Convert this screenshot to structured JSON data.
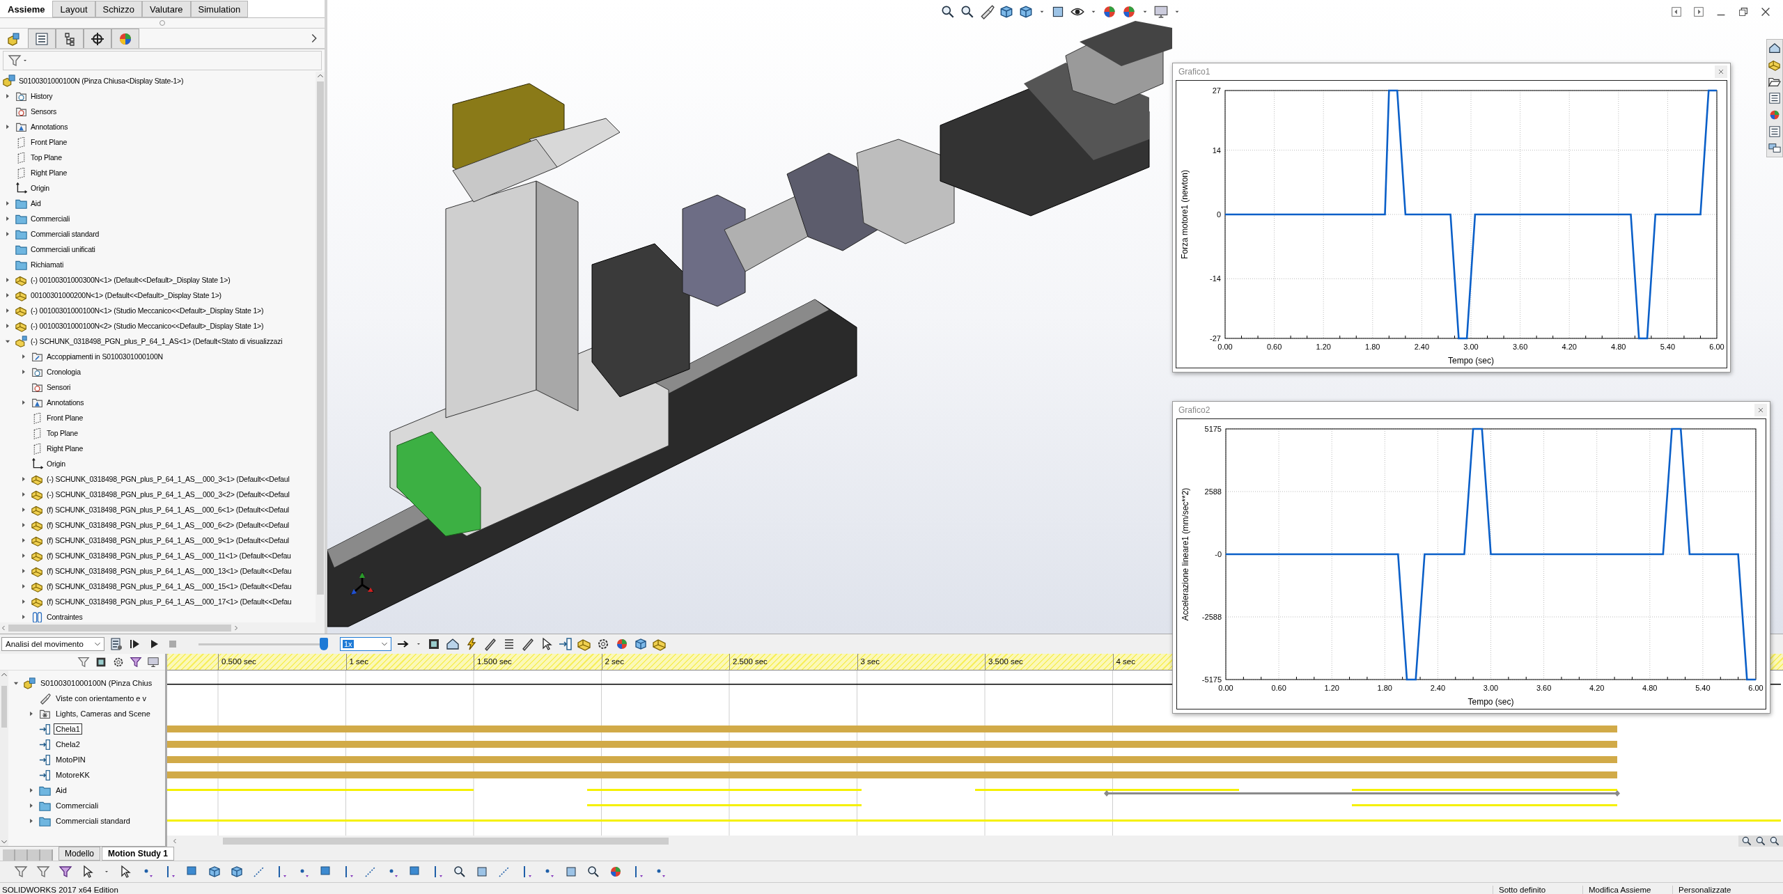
{
  "ribbon_tabs": [
    {
      "label": "Assieme",
      "selected": true
    },
    {
      "label": "Layout",
      "selected": false
    },
    {
      "label": "Schizzo",
      "selected": false
    },
    {
      "label": "Valutare",
      "selected": false
    },
    {
      "label": "Simulation",
      "selected": false
    }
  ],
  "panel_tabs": [
    {
      "kind": "tree",
      "selected": true
    },
    {
      "kind": "properties",
      "selected": false
    },
    {
      "kind": "configurations",
      "selected": false
    },
    {
      "kind": "dimxpert",
      "selected": false
    },
    {
      "kind": "display",
      "selected": false
    }
  ],
  "tree": {
    "root": {
      "label": "S0100301000100N  (Pinza Chiusa<Display State-1>)",
      "kind": "assembly"
    },
    "items": [
      {
        "label": "History",
        "kind": "history",
        "expanded": false
      },
      {
        "label": "Sensors",
        "kind": "sensor"
      },
      {
        "label": "Annotations",
        "kind": "annotation",
        "expanded": false
      },
      {
        "label": "Front Plane",
        "kind": "plane"
      },
      {
        "label": "Top Plane",
        "kind": "plane"
      },
      {
        "label": "Right Plane",
        "kind": "plane"
      },
      {
        "label": "Origin",
        "kind": "origin"
      },
      {
        "label": "Aid",
        "kind": "folder",
        "expanded": false
      },
      {
        "label": "Commerciali",
        "kind": "folder",
        "expanded": false
      },
      {
        "label": "Commerciali standard",
        "kind": "folder",
        "expanded": false
      },
      {
        "label": "Commerciali unificati",
        "kind": "folder"
      },
      {
        "label": "Richiamati",
        "kind": "folder"
      },
      {
        "label": "(-) 00100301000300N<1> (Default<<Default>_Display State 1>)",
        "kind": "part",
        "expanded": false
      },
      {
        "label": "00100301000200N<1> (Default<<Default>_Display State 1>)",
        "kind": "part",
        "expanded": false
      },
      {
        "label": "(-) 00100301000100N<1> (Studio Meccanico<<Default>_Display State 1>)",
        "kind": "part",
        "expanded": false
      },
      {
        "label": "(-) 00100301000100N<2> (Studio Meccanico<<Default>_Display State 1>)",
        "kind": "part",
        "expanded": false
      },
      {
        "label": "(-) SCHUNK_0318498_PGN_plus_P_64_1_AS<1> (Default<Stato di visualizzazi",
        "kind": "subassembly",
        "expanded": true,
        "children": [
          {
            "label": "Accoppiamenti in S0100301000100N",
            "kind": "mates",
            "expanded": false
          },
          {
            "label": "Cronologia",
            "kind": "history",
            "expanded": false
          },
          {
            "label": "Sensori",
            "kind": "sensor"
          },
          {
            "label": "Annotations",
            "kind": "annotation",
            "expanded": false
          },
          {
            "label": "Front Plane",
            "kind": "plane"
          },
          {
            "label": "Top Plane",
            "kind": "plane"
          },
          {
            "label": "Right Plane",
            "kind": "plane"
          },
          {
            "label": "Origin",
            "kind": "origin"
          },
          {
            "label": "(-) SCHUNK_0318498_PGN_plus_P_64_1_AS__000_3<1> (Default<<Defaul",
            "kind": "part",
            "expanded": false
          },
          {
            "label": "(-) SCHUNK_0318498_PGN_plus_P_64_1_AS__000_3<2> (Default<<Defaul",
            "kind": "part",
            "expanded": false
          },
          {
            "label": "(f) SCHUNK_0318498_PGN_plus_P_64_1_AS__000_6<1> (Default<<Defaul",
            "kind": "part",
            "expanded": false
          },
          {
            "label": "(f) SCHUNK_0318498_PGN_plus_P_64_1_AS__000_6<2> (Default<<Defaul",
            "kind": "part",
            "expanded": false
          },
          {
            "label": "(f) SCHUNK_0318498_PGN_plus_P_64_1_AS__000_9<1> (Default<<Defaul",
            "kind": "part",
            "expanded": false
          },
          {
            "label": "(f) SCHUNK_0318498_PGN_plus_P_64_1_AS__000_11<1> (Default<<Defau",
            "kind": "part",
            "expanded": false
          },
          {
            "label": "(f) SCHUNK_0318498_PGN_plus_P_64_1_AS__000_13<1> (Default<<Defau",
            "kind": "part",
            "expanded": false
          },
          {
            "label": "(f) SCHUNK_0318498_PGN_plus_P_64_1_AS__000_15<1> (Default<<Defau",
            "kind": "part",
            "expanded": false
          },
          {
            "label": "(f) SCHUNK_0318498_PGN_plus_P_64_1_AS__000_17<1> (Default<<Defau",
            "kind": "part",
            "expanded": false
          },
          {
            "label": "Contraintes",
            "kind": "paperclip",
            "expanded": false
          }
        ]
      }
    ]
  },
  "graphs": [
    {
      "title": "Grafico1",
      "chart_data": {
        "type": "line",
        "grid": true,
        "xlabel": "Tempo (sec)",
        "ylabel": "Forza motore1 (newton)",
        "xlim": [
          0,
          6
        ],
        "ylim": [
          -27,
          27
        ],
        "x": [
          0,
          1.95,
          2.0,
          2.1,
          2.2,
          2.75,
          2.85,
          2.95,
          3.05,
          4.95,
          5.05,
          5.15,
          5.25,
          5.8,
          5.9,
          6.0
        ],
        "values": [
          0,
          0,
          27,
          27,
          0,
          0,
          -27,
          -27,
          0,
          0,
          -27,
          -27,
          0,
          0,
          27,
          27
        ],
        "xticks": [
          {
            "value": 0,
            "label": "0.00"
          },
          {
            "value": 0.6,
            "label": "0.60"
          },
          {
            "value": 1.2,
            "label": "1.20"
          },
          {
            "value": 1.8,
            "label": "1.80"
          },
          {
            "value": 2.4,
            "label": "2.40"
          },
          {
            "value": 3.0,
            "label": "3.00"
          },
          {
            "value": 3.6,
            "label": "3.60"
          },
          {
            "value": 4.2,
            "label": "4.20"
          },
          {
            "value": 4.8,
            "label": "4.80"
          },
          {
            "value": 5.4,
            "label": "5.40"
          },
          {
            "value": 6.0,
            "label": "6.00"
          }
        ],
        "yticks": [
          {
            "value": -27,
            "label": "-27"
          },
          {
            "value": -14,
            "label": "-14"
          },
          {
            "value": 0,
            "label": "0"
          },
          {
            "value": 14,
            "label": "14"
          },
          {
            "value": 27,
            "label": "27"
          }
        ]
      }
    },
    {
      "title": "Grafico2",
      "chart_data": {
        "type": "line",
        "grid": true,
        "xlabel": "Tempo (sec)",
        "ylabel": "Accelerazione lineare1 (mm/sec**2)",
        "xlim": [
          0,
          6
        ],
        "ylim": [
          -5175,
          5175
        ],
        "x": [
          0,
          1.95,
          2.05,
          2.15,
          2.25,
          2.7,
          2.8,
          2.9,
          3.0,
          4.95,
          5.05,
          5.15,
          5.25,
          5.8,
          5.9,
          6.0
        ],
        "values": [
          0,
          0,
          -5175,
          -5175,
          0,
          0,
          5175,
          5175,
          0,
          0,
          5175,
          5175,
          0,
          0,
          -5175,
          -5175
        ],
        "xticks": [
          {
            "value": 0,
            "label": "0.00"
          },
          {
            "value": 0.6,
            "label": "0.60"
          },
          {
            "value": 1.2,
            "label": "1.20"
          },
          {
            "value": 1.8,
            "label": "1.80"
          },
          {
            "value": 2.4,
            "label": "2.40"
          },
          {
            "value": 3.0,
            "label": "3.00"
          },
          {
            "value": 3.6,
            "label": "3.60"
          },
          {
            "value": 4.2,
            "label": "4.20"
          },
          {
            "value": 4.8,
            "label": "4.80"
          },
          {
            "value": 5.4,
            "label": "5.40"
          },
          {
            "value": 6.0,
            "label": "6.00"
          }
        ],
        "yticks": [
          {
            "value": -5175,
            "label": "-5175"
          },
          {
            "value": -2588,
            "label": "-2588"
          },
          {
            "value": 0,
            "label": "-0"
          },
          {
            "value": 2588,
            "label": "2588"
          },
          {
            "value": 5175,
            "label": "5175"
          }
        ]
      }
    }
  ],
  "motion_study": {
    "study_type": "Analisi del movimento",
    "time_slider": {
      "level": 1
    },
    "playback_speed": "1x",
    "ruler": [
      "0.500 sec",
      "1 sec",
      "1.500 sec",
      "2 sec",
      "2.500 sec",
      "3 sec",
      "3.500 sec",
      "4 sec"
    ],
    "tree": [
      {
        "label": "S0100301000100N  (Pinza Chius",
        "kind": "assembly",
        "expanded": true,
        "selected": false,
        "children": [
          {
            "label": "Viste con orientamento e v",
            "kind": "camera",
            "selected": false
          },
          {
            "label": "Lights, Cameras and Scene",
            "kind": "lights",
            "expanded": false,
            "selected": false
          },
          {
            "label": "Chela1",
            "kind": "motor",
            "selected": true
          },
          {
            "label": "Chela2",
            "kind": "motor",
            "selected": false
          },
          {
            "label": "MotoPIN",
            "kind": "motor",
            "selected": false
          },
          {
            "label": "MotoreKK",
            "kind": "motor",
            "selected": false
          },
          {
            "label": "Aid",
            "kind": "folder",
            "expanded": false,
            "selected": false
          },
          {
            "label": "Commerciali",
            "kind": "folder",
            "expanded": false,
            "selected": false
          },
          {
            "label": "Commerciali standard",
            "kind": "folder",
            "expanded": false,
            "selected": false
          }
        ]
      }
    ]
  },
  "bottom_tabs": [
    {
      "label": "Modello",
      "selected": false
    },
    {
      "label": "Motion Study 1",
      "selected": true
    }
  ],
  "status_bar": {
    "product": "SOLIDWORKS 2017 x64 Edition",
    "fields": [
      "Sotto definito",
      "Modifica Assieme",
      "Personalizzate"
    ]
  }
}
